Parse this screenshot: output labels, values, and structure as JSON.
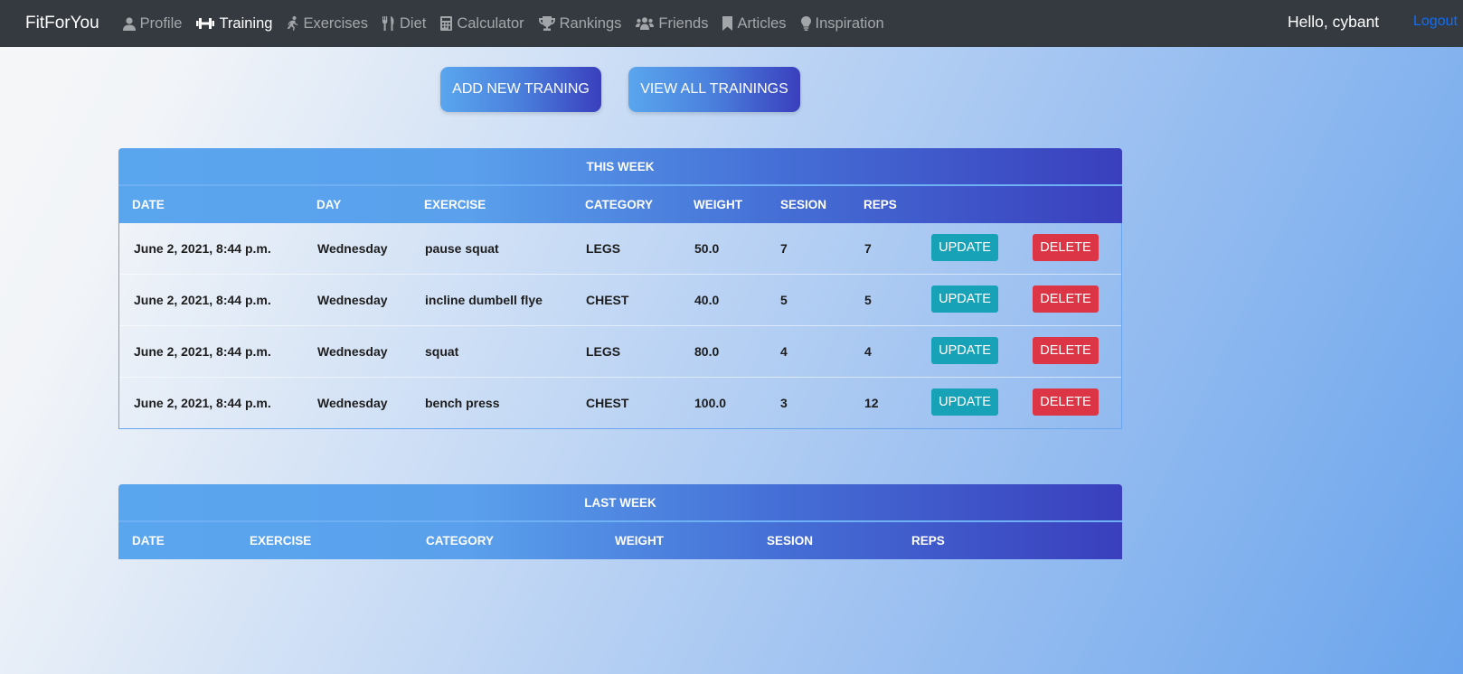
{
  "nav": {
    "brand": "FitForYou",
    "items": [
      {
        "label": "Profile",
        "icon": "user-icon"
      },
      {
        "label": "Training",
        "icon": "dumbbell-icon",
        "active": true
      },
      {
        "label": "Exercises",
        "icon": "running-icon"
      },
      {
        "label": "Diet",
        "icon": "utensils-icon"
      },
      {
        "label": "Calculator",
        "icon": "calculator-icon"
      },
      {
        "label": "Rankings",
        "icon": "trophy-icon"
      },
      {
        "label": "Friends",
        "icon": "users-icon"
      },
      {
        "label": "Articles",
        "icon": "bookmark-icon"
      },
      {
        "label": "Inspiration",
        "icon": "lightbulb-icon"
      }
    ],
    "greeting": "Hello, cybant",
    "logout": "Logout"
  },
  "actions": {
    "add_label": "ADD NEW TRANING",
    "view_label": "VIEW ALL TRAININGS"
  },
  "this_week": {
    "title": "THIS WEEK",
    "columns": [
      "DATE",
      "DAY",
      "EXERCISE",
      "CATEGORY",
      "WEIGHT",
      "SESION",
      "REPS"
    ],
    "update_label": "UPDATE",
    "delete_label": "DELETE",
    "rows": [
      {
        "date": "June 2, 2021, 8:44 p.m.",
        "day": "Wednesday",
        "exercise": "pause squat",
        "category": "LEGS",
        "weight": "50.0",
        "sesion": "7",
        "reps": "7"
      },
      {
        "date": "June 2, 2021, 8:44 p.m.",
        "day": "Wednesday",
        "exercise": "incline dumbell flye",
        "category": "CHEST",
        "weight": "40.0",
        "sesion": "5",
        "reps": "5"
      },
      {
        "date": "June 2, 2021, 8:44 p.m.",
        "day": "Wednesday",
        "exercise": "squat",
        "category": "LEGS",
        "weight": "80.0",
        "sesion": "4",
        "reps": "4"
      },
      {
        "date": "June 2, 2021, 8:44 p.m.",
        "day": "Wednesday",
        "exercise": "bench press",
        "category": "CHEST",
        "weight": "100.0",
        "sesion": "3",
        "reps": "12"
      }
    ]
  },
  "last_week": {
    "title": "LAST WEEK",
    "columns": [
      "DATE",
      "EXERCISE",
      "CATEGORY",
      "WEIGHT",
      "SESION",
      "REPS"
    ]
  }
}
